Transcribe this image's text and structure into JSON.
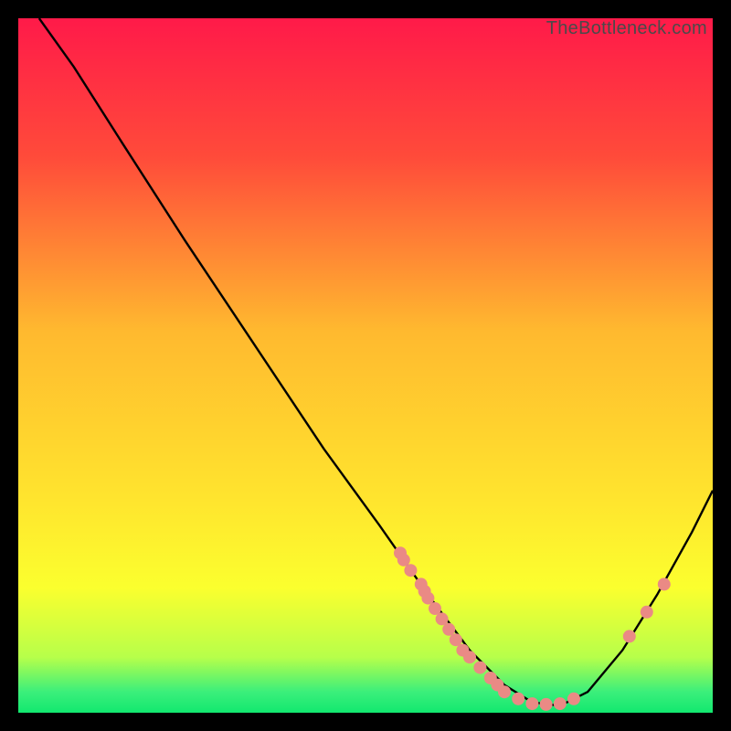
{
  "watermark": "TheBottleneck.com",
  "chart_data": {
    "type": "line",
    "title": "",
    "xlabel": "",
    "ylabel": "",
    "xlim": [
      0,
      100
    ],
    "ylim": [
      0,
      100
    ],
    "gradient_stops": [
      {
        "offset": 0.0,
        "color": "#ff1a49"
      },
      {
        "offset": 0.2,
        "color": "#ff4b3a"
      },
      {
        "offset": 0.45,
        "color": "#ffb92f"
      },
      {
        "offset": 0.7,
        "color": "#ffe62e"
      },
      {
        "offset": 0.82,
        "color": "#fbff2e"
      },
      {
        "offset": 0.92,
        "color": "#b7ff4a"
      },
      {
        "offset": 0.97,
        "color": "#3bef7b"
      },
      {
        "offset": 1.0,
        "color": "#12e86f"
      }
    ],
    "series": [
      {
        "name": "curve",
        "points": [
          {
            "x": 3.0,
            "y": 100.0
          },
          {
            "x": 8.0,
            "y": 93.0
          },
          {
            "x": 15.0,
            "y": 82.0
          },
          {
            "x": 24.0,
            "y": 68.0
          },
          {
            "x": 34.0,
            "y": 53.0
          },
          {
            "x": 44.0,
            "y": 38.0
          },
          {
            "x": 52.0,
            "y": 27.0
          },
          {
            "x": 59.0,
            "y": 17.0
          },
          {
            "x": 65.0,
            "y": 9.0
          },
          {
            "x": 70.0,
            "y": 4.0
          },
          {
            "x": 74.0,
            "y": 1.5
          },
          {
            "x": 78.0,
            "y": 1.0
          },
          {
            "x": 82.0,
            "y": 3.0
          },
          {
            "x": 87.0,
            "y": 9.0
          },
          {
            "x": 92.0,
            "y": 17.0
          },
          {
            "x": 97.0,
            "y": 26.0
          },
          {
            "x": 100.0,
            "y": 32.0
          }
        ]
      },
      {
        "name": "dots",
        "points": [
          {
            "x": 55.0,
            "y": 23.0
          },
          {
            "x": 55.5,
            "y": 22.0
          },
          {
            "x": 56.5,
            "y": 20.5
          },
          {
            "x": 58.0,
            "y": 18.5
          },
          {
            "x": 58.5,
            "y": 17.5
          },
          {
            "x": 59.0,
            "y": 16.5
          },
          {
            "x": 60.0,
            "y": 15.0
          },
          {
            "x": 61.0,
            "y": 13.5
          },
          {
            "x": 62.0,
            "y": 12.0
          },
          {
            "x": 63.0,
            "y": 10.5
          },
          {
            "x": 64.0,
            "y": 9.0
          },
          {
            "x": 65.0,
            "y": 8.0
          },
          {
            "x": 66.5,
            "y": 6.5
          },
          {
            "x": 68.0,
            "y": 5.0
          },
          {
            "x": 69.0,
            "y": 4.0
          },
          {
            "x": 70.0,
            "y": 3.0
          },
          {
            "x": 72.0,
            "y": 2.0
          },
          {
            "x": 74.0,
            "y": 1.3
          },
          {
            "x": 76.0,
            "y": 1.2
          },
          {
            "x": 78.0,
            "y": 1.3
          },
          {
            "x": 80.0,
            "y": 2.0
          },
          {
            "x": 88.0,
            "y": 11.0
          },
          {
            "x": 90.5,
            "y": 14.5
          },
          {
            "x": 93.0,
            "y": 18.5
          }
        ]
      }
    ],
    "dot_color": "#ea8a85",
    "curve_color": "#000000"
  }
}
